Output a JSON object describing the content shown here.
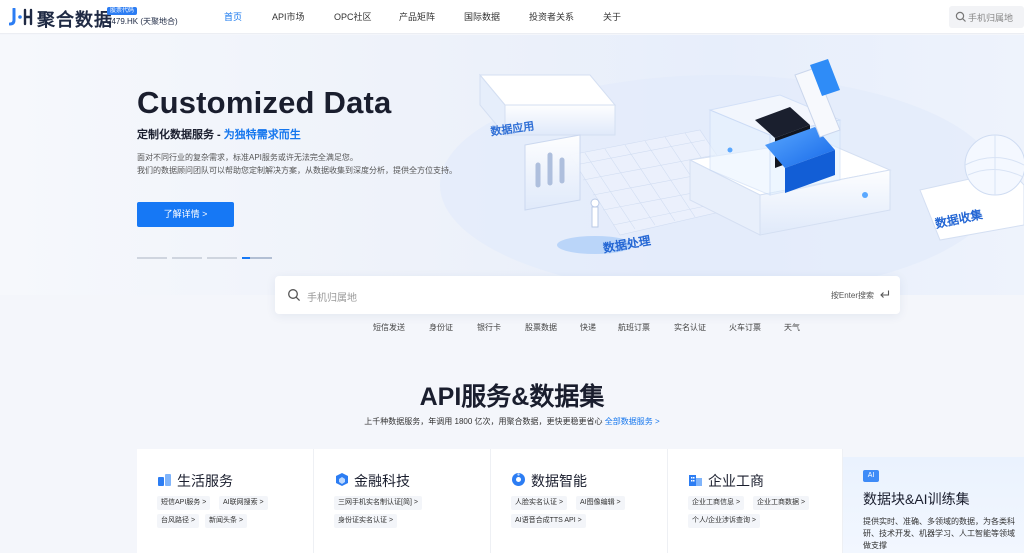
{
  "brand": {
    "name": "聚合数据",
    "stock_tag": "股票代码",
    "stock_code": "2479.HK (天聚地合)",
    "accent": "#1476ee"
  },
  "nav": {
    "items": [
      {
        "label": "首页",
        "active": true
      },
      {
        "label": "API市场"
      },
      {
        "label": "OPC社区"
      },
      {
        "label": "产品矩阵"
      },
      {
        "label": "国际数据"
      },
      {
        "label": "投资者关系"
      },
      {
        "label": "关于"
      }
    ],
    "search_placeholder": "手机归属地"
  },
  "hero": {
    "title": "Customized Data",
    "subtitle_prefix": "定制化数据服务 - ",
    "subtitle_highlight": "为独特需求而生",
    "desc_line1": "面对不同行业的复杂需求，标准API服务或许无法完全满足您。",
    "desc_line2": "我们的数据顾问团队可以帮助您定制解决方案，从数据收集到深度分析，提供全方位支持。",
    "cta_label": "了解详情 >",
    "carousel_active": 4,
    "illus_labels": {
      "app": "数据应用",
      "process": "数据处理",
      "collect": "数据收集"
    }
  },
  "search": {
    "placeholder": "手机归属地",
    "hint": "按Enter搜索",
    "quick_links": [
      "短信发送",
      "身份证",
      "银行卡",
      "股票数据",
      "快递",
      "航班订票",
      "实名认证",
      "火车订票",
      "天气"
    ]
  },
  "section": {
    "title": "API服务&数据集",
    "desc": "上千种数据服务，年调用 1800 亿次，用聚合数据，更快更稳更省心",
    "desc_link": "全部数据服务 >",
    "cards": [
      {
        "title": "生活服务",
        "icon": "life-icon",
        "tags": [
          "短信API服务 >",
          "AI联网搜索 >",
          "台风路径 >",
          "新闻头条 >"
        ]
      },
      {
        "title": "金融科技",
        "icon": "finance-icon",
        "tags": [
          "三网手机实名制认证[简] >",
          "身份证实名认证 >"
        ]
      },
      {
        "title": "数据智能",
        "icon": "intel-icon",
        "tags": [
          "人脸实名认证 >",
          "AI图像编辑 >",
          "AI语音合成TTS API >"
        ]
      },
      {
        "title": "企业工商",
        "icon": "business-icon",
        "tags": [
          "企业工商信息 >",
          "企业工商数据 >",
          "个人/企业涉诉查询 >"
        ]
      }
    ],
    "highlight": {
      "badge": "AI",
      "title": "数据块&AI训练集",
      "desc": "提供实时、准确、多领域的数据，为各类科研、技术开发、机器学习、人工智能等领域做支撑"
    }
  }
}
